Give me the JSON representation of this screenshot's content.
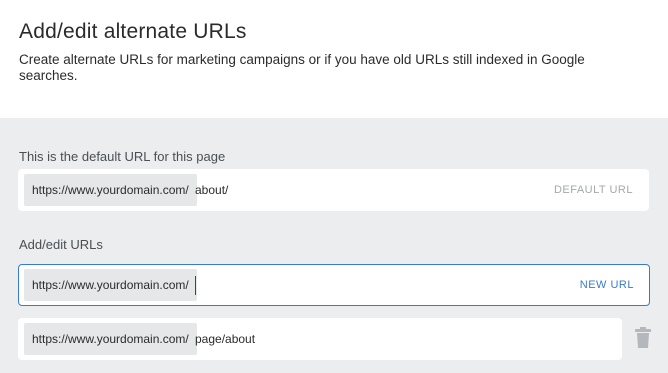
{
  "header": {
    "title": "Add/edit alternate URLs",
    "description": "Create alternate URLs for marketing campaigns or if you have old URLs still indexed in Google searches."
  },
  "default_section": {
    "label": "This is the default URL for this page",
    "prefix": "https://www.yourdomain.com/",
    "path": "about/",
    "tag": "DEFAULT URL"
  },
  "edit_section": {
    "label": "Add/edit URLs",
    "new_row": {
      "prefix": "https://www.yourdomain.com/",
      "value": "",
      "tag": "NEW URL"
    },
    "rows": [
      {
        "prefix": "https://www.yourdomain.com/",
        "path": "page/about",
        "action_icon": "trash-icon"
      }
    ]
  },
  "colors": {
    "accent": "#3a7bc8",
    "panel_bg": "#ebedee",
    "prefix_bg": "#e6e7e8",
    "muted_tag": "#a3a8ad"
  }
}
